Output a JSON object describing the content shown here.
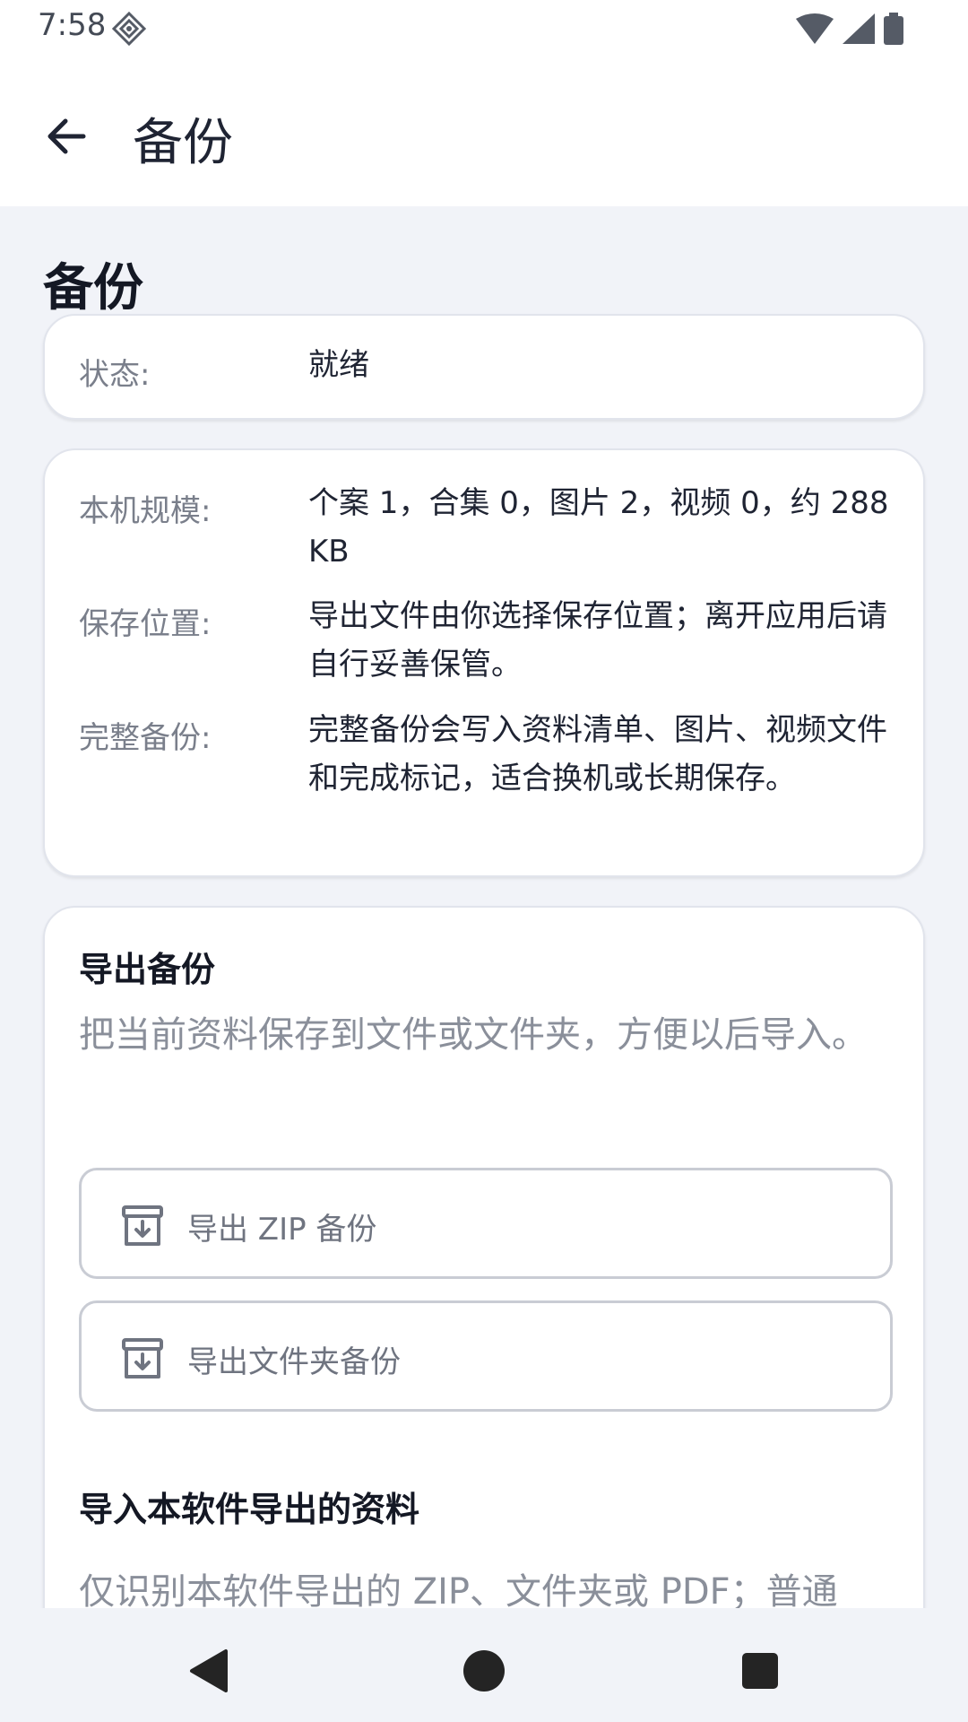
{
  "status_bar": {
    "time": "7:58",
    "icons": [
      "app-notification-icon",
      "wifi-icon",
      "signal-icon",
      "battery-icon"
    ]
  },
  "app_bar": {
    "title": "备份",
    "back_icon": "arrow-left-icon"
  },
  "page": {
    "section_title": "备份",
    "status_card": {
      "label": "状态:",
      "value": "就绪"
    },
    "info_card": {
      "rows": [
        {
          "label": "本机规模:",
          "value": "个案 1，合集 0，图片 2，视频 0，约 288 KB"
        },
        {
          "label": "保存位置:",
          "value": "导出文件由你选择保存位置；离开应用后请自行妥善保管。"
        },
        {
          "label": "完整备份:",
          "value": "完整备份会写入资料清单、图片、视频文件和完成标记，适合换机或长期保存。"
        }
      ]
    },
    "export_card": {
      "heading": "导出备份",
      "description": "把当前资料保存到文件或文件夹，方便以后导入。",
      "buttons": [
        {
          "label": "导出 ZIP 备份",
          "icon": "archive-download-icon"
        },
        {
          "label": "导出文件夹备份",
          "icon": "archive-download-icon"
        }
      ],
      "import_heading": "导入本软件导出的资料",
      "import_description": "仅识别本软件导出的 ZIP、文件夹或 PDF；普通"
    }
  },
  "nav_bar": {
    "buttons": [
      "back-triangle-icon",
      "home-circle-icon",
      "recents-square-icon"
    ]
  }
}
